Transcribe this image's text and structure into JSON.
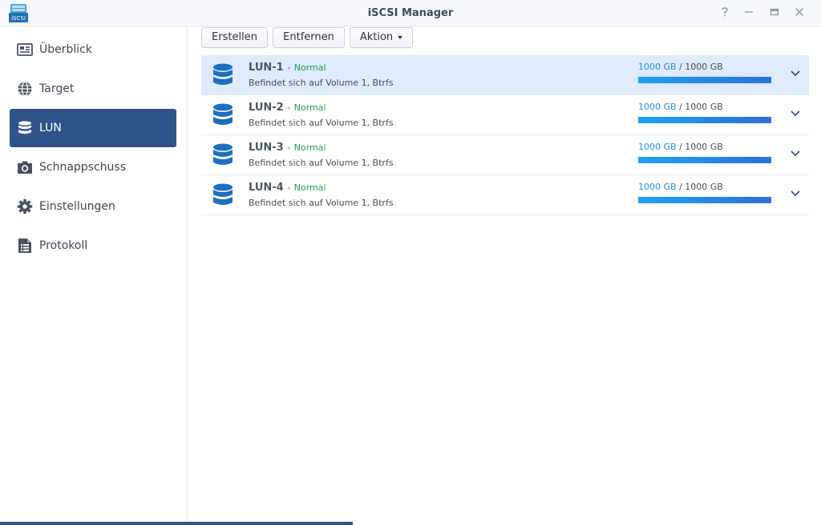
{
  "window": {
    "title": "iSCSI Manager",
    "app_icon_text": "iSCSI",
    "controls": [
      "help-icon",
      "minimize-icon",
      "maximize-icon",
      "close-icon"
    ]
  },
  "sidebar": {
    "items": [
      {
        "label": "Überblick",
        "icon": "overview-icon",
        "active": false
      },
      {
        "label": "Target",
        "icon": "globe-icon",
        "active": false
      },
      {
        "label": "LUN",
        "icon": "database-icon",
        "active": true
      },
      {
        "label": "Schnappschuss",
        "icon": "camera-icon",
        "active": false
      },
      {
        "label": "Einstellungen",
        "icon": "gear-icon",
        "active": false
      },
      {
        "label": "Protokoll",
        "icon": "log-icon",
        "active": false
      }
    ]
  },
  "toolbar": {
    "create_label": "Erstellen",
    "remove_label": "Entfernen",
    "action_label": "Aktion"
  },
  "luns": [
    {
      "name": "LUN-1",
      "status": "Normal",
      "location": "Befindet sich auf Volume 1, Btrfs",
      "used": "1000 GB",
      "total": "1000 GB",
      "usage_percent": 100
    },
    {
      "name": "LUN-2",
      "status": "Normal",
      "location": "Befindet sich auf Volume 1, Btrfs",
      "used": "1000 GB",
      "total": "1000 GB",
      "usage_percent": 100
    },
    {
      "name": "LUN-3",
      "status": "Normal",
      "location": "Befindet sich auf Volume 1, Btrfs",
      "used": "1000 GB",
      "total": "1000 GB",
      "usage_percent": 100
    },
    {
      "name": "LUN-4",
      "status": "Normal",
      "location": "Befindet sich auf Volume 1, Btrfs",
      "used": "1000 GB",
      "total": "1000 GB",
      "usage_percent": 100
    }
  ],
  "colors": {
    "accent": "#2f5489",
    "status_normal": "#24a148",
    "capacity_used": "#1f8fe0",
    "selected_row": "#dfeafa"
  }
}
